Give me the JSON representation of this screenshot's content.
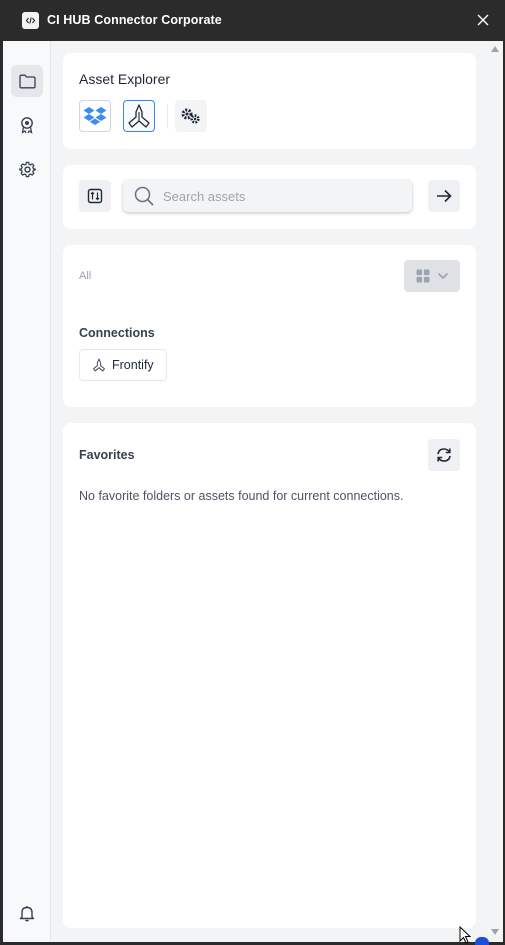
{
  "window": {
    "title": "CI HUB Connector Corporate"
  },
  "asset_explorer": {
    "title": "Asset Explorer"
  },
  "search": {
    "placeholder": "Search assets"
  },
  "browse": {
    "filter_label": "All",
    "connections_title": "Connections",
    "connections": [
      "Frontify"
    ]
  },
  "favorites": {
    "title": "Favorites",
    "empty_message": "No favorite folders or assets found for current connections."
  },
  "colors": {
    "titlebar": "#2b2b2b",
    "accent": "#3b82f6",
    "dropbox": "#3d8cf0"
  }
}
